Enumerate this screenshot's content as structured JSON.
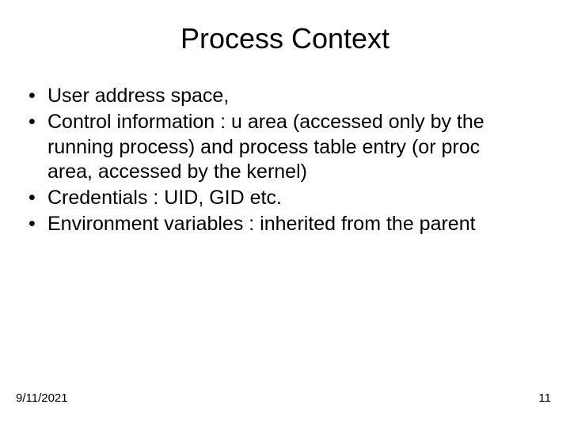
{
  "title": "Process Context",
  "bullets": [
    "User address space,",
    "Control information : u area (accessed only by the running process)  and process table entry (or proc area, accessed by the kernel)",
    "Credentials : UID, GID etc.",
    "Environment variables :  inherited from the parent"
  ],
  "footer": {
    "date": "9/11/2021",
    "page": "11"
  }
}
